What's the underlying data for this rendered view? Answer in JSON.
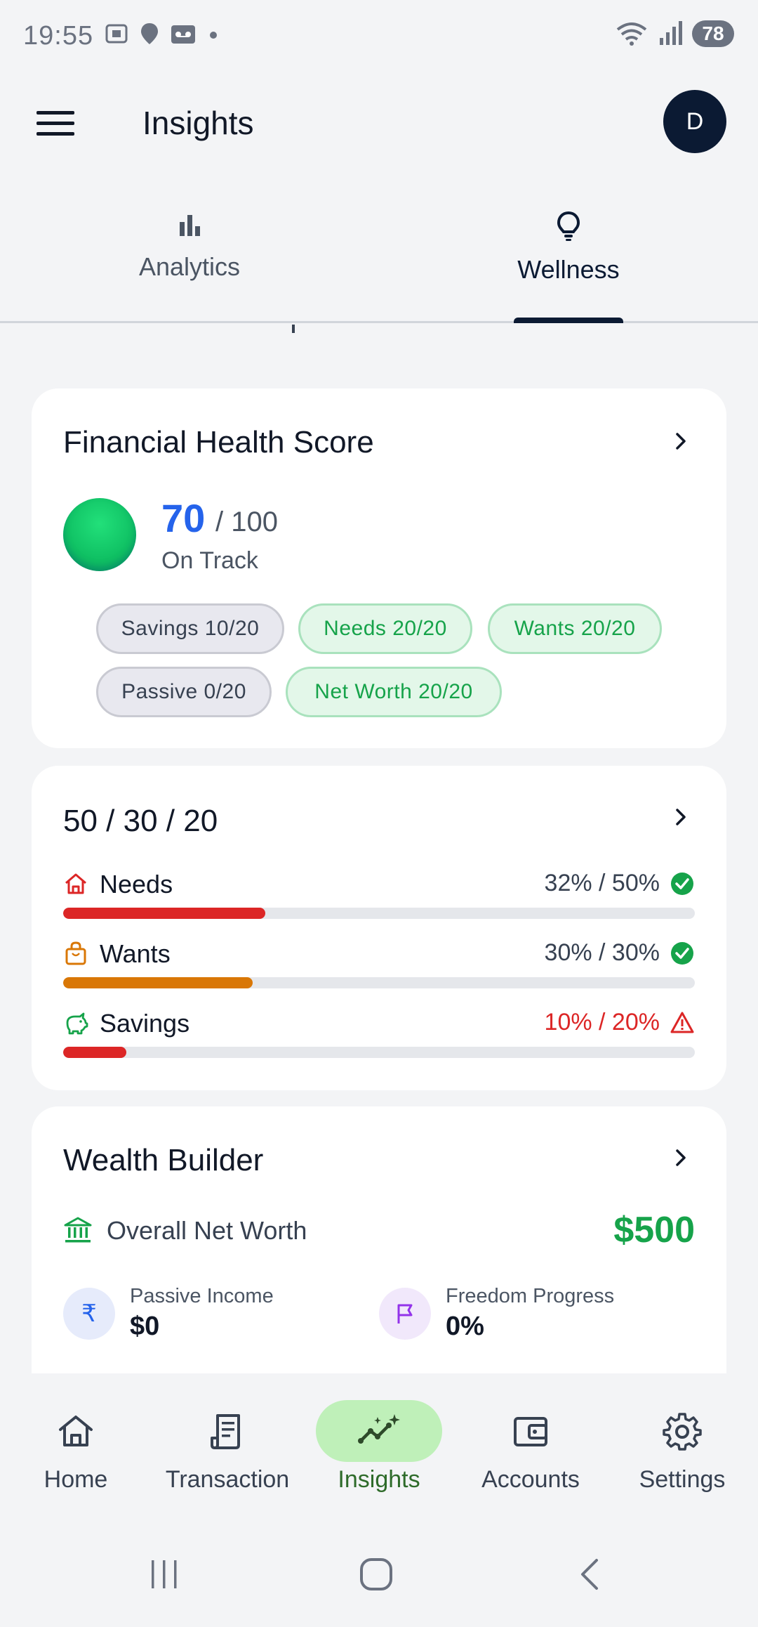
{
  "status_bar": {
    "time": "19:55",
    "battery": "78"
  },
  "app_bar": {
    "title": "Insights",
    "avatar_initial": "D"
  },
  "tabs": [
    {
      "label": "Analytics",
      "icon": "bar-chart-icon",
      "active": false
    },
    {
      "label": "Wellness",
      "icon": "lightbulb-icon",
      "active": true
    }
  ],
  "health_score": {
    "title": "Financial Health Score",
    "score": "70",
    "max": "/ 100",
    "status": "On Track",
    "chips": [
      {
        "label": "Savings 10/20",
        "variant": "gray"
      },
      {
        "label": "Needs 20/20",
        "variant": "green"
      },
      {
        "label": "Wants 20/20",
        "variant": "green"
      },
      {
        "label": "Passive 0/20",
        "variant": "gray"
      },
      {
        "label": "Net Worth 20/20",
        "variant": "green"
      }
    ]
  },
  "budget_rule": {
    "title": "50 / 30 / 20",
    "rows": [
      {
        "label": "Needs",
        "value": "32% / 50%",
        "actual_percent": 32,
        "status": "ok",
        "color": "#dc2626"
      },
      {
        "label": "Wants",
        "value": "30% / 30%",
        "actual_percent": 30,
        "status": "ok",
        "color": "#d97706"
      },
      {
        "label": "Savings",
        "value": "10% / 20%",
        "actual_percent": 10,
        "status": "warning",
        "color": "#dc2626"
      }
    ]
  },
  "wealth_builder": {
    "title": "Wealth Builder",
    "net_worth_label": "Overall Net Worth",
    "net_worth_value": "$500",
    "passive_income_label": "Passive Income",
    "passive_income_value": "$0",
    "freedom_label": "Freedom Progress",
    "freedom_value": "0%"
  },
  "bottom_nav": [
    {
      "label": "Home",
      "icon": "home-icon",
      "active": false
    },
    {
      "label": "Transaction",
      "icon": "receipt-icon",
      "active": false
    },
    {
      "label": "Insights",
      "icon": "trend-sparkle-icon",
      "active": true
    },
    {
      "label": "Accounts",
      "icon": "wallet-icon",
      "active": false
    },
    {
      "label": "Settings",
      "icon": "gear-icon",
      "active": false
    }
  ],
  "colors": {
    "accent_navy": "#0b1a33",
    "score_blue": "#2563eb",
    "positive_green": "#16a34a",
    "alert_red": "#dc2626",
    "wants_orange": "#d97706",
    "nav_active_bg": "#bff0b9"
  }
}
